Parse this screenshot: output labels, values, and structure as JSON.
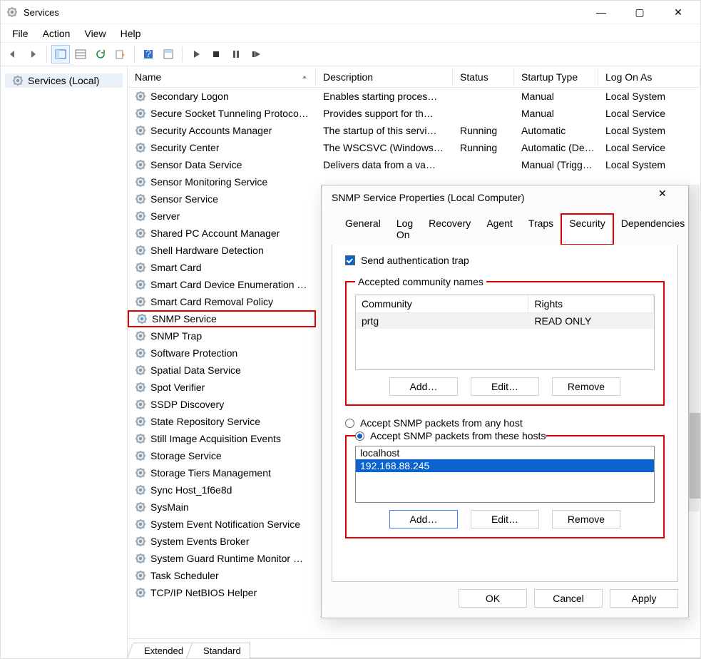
{
  "window": {
    "title": "Services",
    "controls": {
      "min": "—",
      "max": "▢",
      "close": "✕"
    },
    "menu": [
      "File",
      "Action",
      "View",
      "Help"
    ],
    "tree": {
      "root": "Services (Local)"
    }
  },
  "columns": {
    "name": "Name",
    "desc": "Description",
    "status": "Status",
    "startup": "Startup Type",
    "logon": "Log On As"
  },
  "services": [
    {
      "name": "Secondary Logon",
      "desc": "Enables starting proces…",
      "status": "",
      "startup": "Manual",
      "logon": "Local System"
    },
    {
      "name": "Secure Socket Tunneling Protocol Se…",
      "desc": "Provides support for th…",
      "status": "",
      "startup": "Manual",
      "logon": "Local Service"
    },
    {
      "name": "Security Accounts Manager",
      "desc": "The startup of this servi…",
      "status": "Running",
      "startup": "Automatic",
      "logon": "Local System"
    },
    {
      "name": "Security Center",
      "desc": "The WSCSVC (Windows…",
      "status": "Running",
      "startup": "Automatic (De…",
      "logon": "Local Service"
    },
    {
      "name": "Sensor Data Service",
      "desc": "Delivers data from a va…",
      "status": "",
      "startup": "Manual (Trigg…",
      "logon": "Local System"
    },
    {
      "name": "Sensor Monitoring Service"
    },
    {
      "name": "Sensor Service"
    },
    {
      "name": "Server"
    },
    {
      "name": "Shared PC Account Manager"
    },
    {
      "name": "Shell Hardware Detection"
    },
    {
      "name": "Smart Card"
    },
    {
      "name": "Smart Card Device Enumeration Serv…"
    },
    {
      "name": "Smart Card Removal Policy"
    },
    {
      "name": "SNMP Service",
      "hl": true
    },
    {
      "name": "SNMP Trap"
    },
    {
      "name": "Software Protection"
    },
    {
      "name": "Spatial Data Service"
    },
    {
      "name": "Spot Verifier"
    },
    {
      "name": "SSDP Discovery"
    },
    {
      "name": "State Repository Service"
    },
    {
      "name": "Still Image Acquisition Events"
    },
    {
      "name": "Storage Service"
    },
    {
      "name": "Storage Tiers Management"
    },
    {
      "name": "Sync Host_1f6e8d"
    },
    {
      "name": "SysMain"
    },
    {
      "name": "System Event Notification Service"
    },
    {
      "name": "System Events Broker"
    },
    {
      "name": "System Guard Runtime Monitor Bro…"
    },
    {
      "name": "Task Scheduler"
    },
    {
      "name": "TCP/IP NetBIOS Helper"
    }
  ],
  "viewtabs": {
    "extended": "Extended",
    "standard": "Standard"
  },
  "dialog": {
    "title": "SNMP Service Properties (Local Computer)",
    "tabs": [
      "General",
      "Log On",
      "Recovery",
      "Agent",
      "Traps",
      "Security",
      "Dependencies"
    ],
    "activeTab": "Security",
    "authTrap": {
      "label": "Send authentication trap",
      "checked": true
    },
    "communities": {
      "legend": "Accepted community names",
      "headers": {
        "community": "Community",
        "rights": "Rights"
      },
      "rows": [
        {
          "community": "prtg",
          "rights": "READ ONLY"
        }
      ],
      "buttons": {
        "add": "Add…",
        "edit": "Edit…",
        "remove": "Remove"
      }
    },
    "hosts": {
      "radioAny": "Accept SNMP packets from any host",
      "radioThese": "Accept SNMP packets from these hosts",
      "selected": "these",
      "legend": "",
      "list": [
        {
          "v": "localhost"
        },
        {
          "v": "192.168.88.245",
          "sel": true
        }
      ],
      "buttons": {
        "add": "Add…",
        "edit": "Edit…",
        "remove": "Remove"
      }
    },
    "footer": {
      "ok": "OK",
      "cancel": "Cancel",
      "apply": "Apply"
    }
  }
}
